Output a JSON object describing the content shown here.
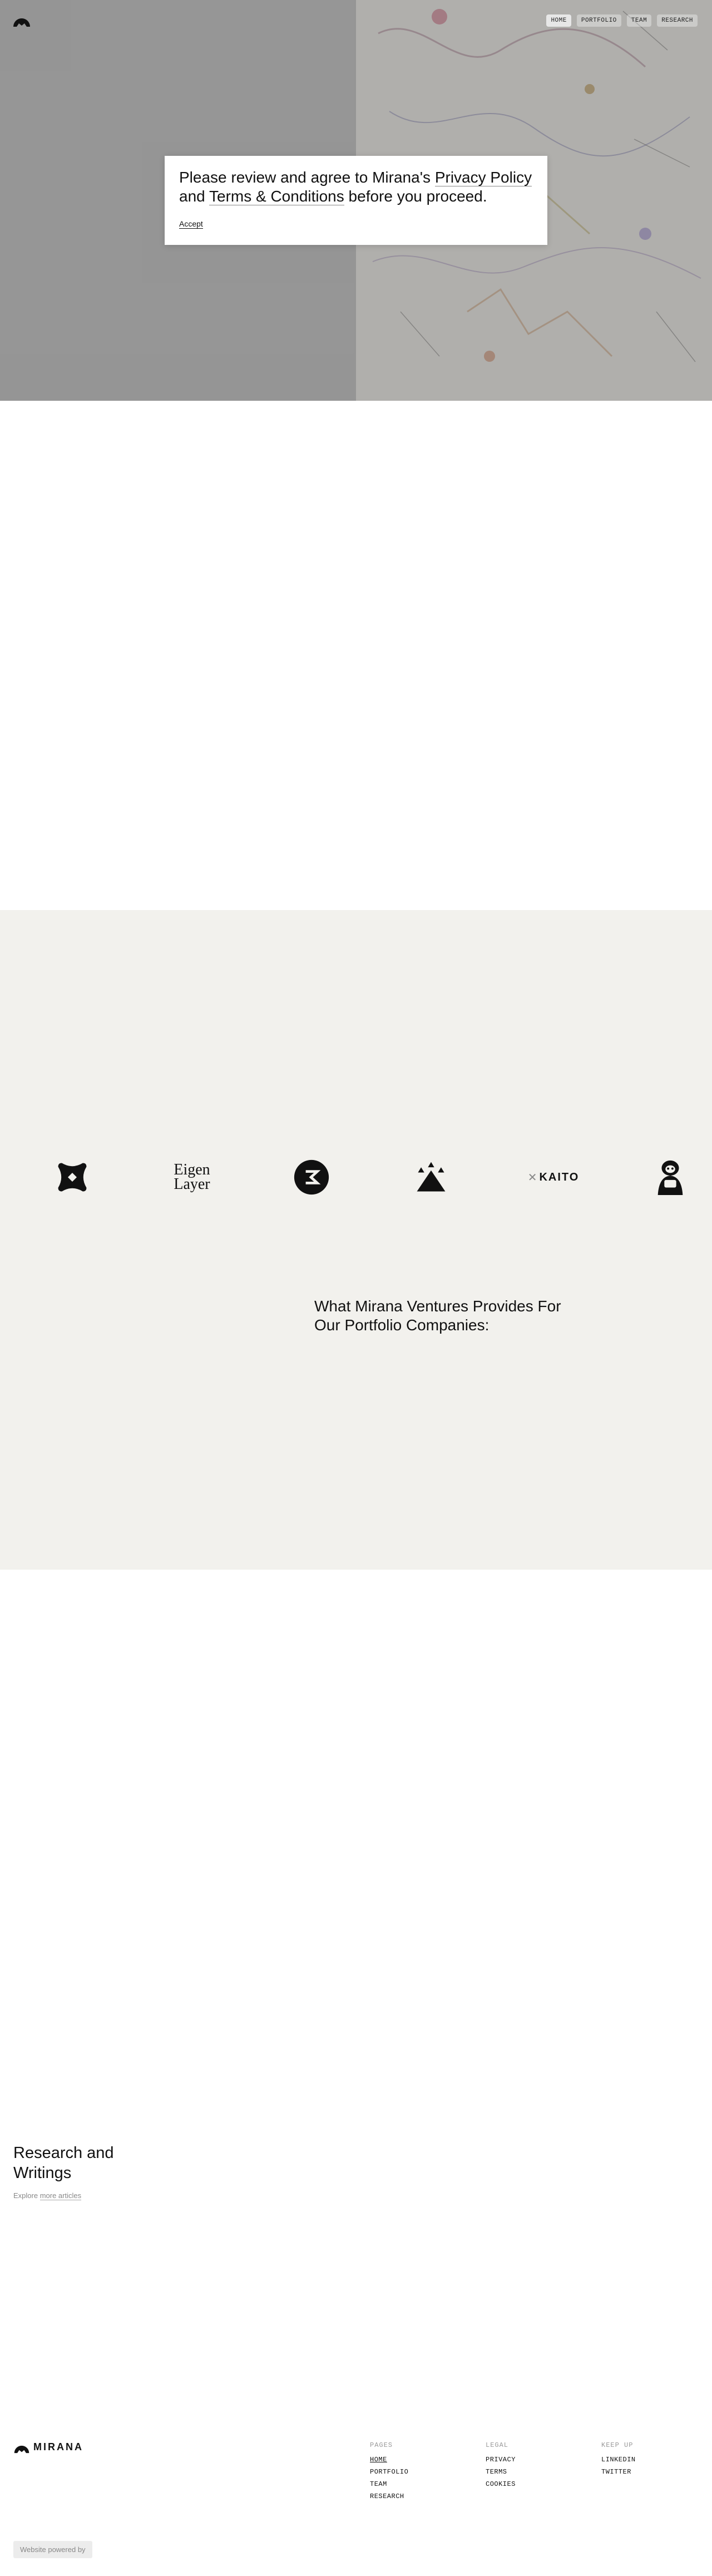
{
  "nav": {
    "items": [
      "HOME",
      "PORTFOLIO",
      "TEAM",
      "RESEARCH"
    ]
  },
  "modal": {
    "text_before_privacy": "Please review and agree to Mirana's ",
    "privacy_link": "Privacy Policy",
    "text_and": " and ",
    "terms_link": "Terms & Conditions",
    "text_after": " before you proceed.",
    "accept_label": "Accept"
  },
  "portfolio": {
    "logos": [
      {
        "icon": "star-cross-logo-icon"
      },
      {
        "icon": "eigenlayer-logo",
        "line1": "Eigen",
        "line2": "Layer"
      },
      {
        "icon": "sigma-circle-logo-icon"
      },
      {
        "icon": "triangle-mountain-logo-icon"
      },
      {
        "icon": "kaito-logo",
        "text": "KAITO"
      },
      {
        "icon": "ape-mascot-logo-icon"
      }
    ],
    "provides_heading": "What Mirana Ventures Provides For Our Portfolio Companies:"
  },
  "research": {
    "title": "Research and Writings",
    "explore_prefix": "Explore ",
    "explore_link": "more articles"
  },
  "footer": {
    "wordmark": "MIRANA",
    "pages": {
      "heading": "PAGES",
      "items": [
        "HOME",
        "PORTFOLIO",
        "TEAM",
        "RESEARCH"
      ]
    },
    "legal": {
      "heading": "LEGAL",
      "items": [
        "PRIVACY",
        "TERMS",
        "COOKIES"
      ]
    },
    "keep_up": {
      "heading": "KEEP UP",
      "items": [
        "LINKEDIN",
        "TWITTER"
      ]
    },
    "powered_by": "Website powered by"
  },
  "colors": {
    "beige": "#f2f1ed",
    "hero_gray": "#9c9c9c"
  }
}
